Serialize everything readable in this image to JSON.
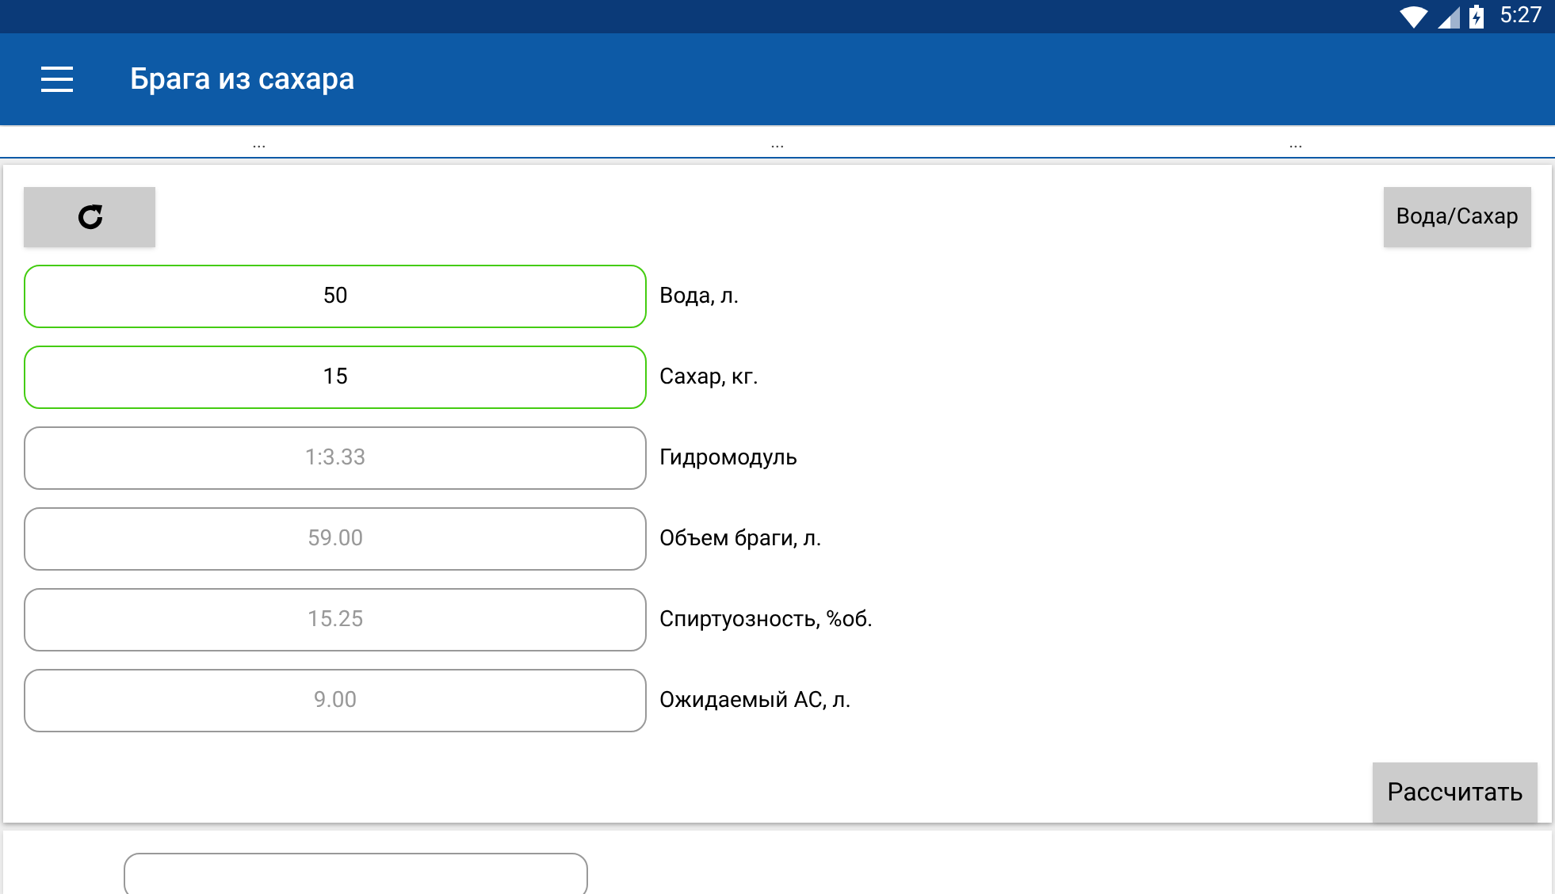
{
  "status_bar": {
    "time": "5:27"
  },
  "app_bar": {
    "title": "Брага из сахара"
  },
  "tabs": [
    {
      "label": "..."
    },
    {
      "label": "..."
    },
    {
      "label": "..."
    }
  ],
  "card": {
    "toggle_button": "Вода/Сахар",
    "fields": [
      {
        "value": "50",
        "label": "Вода, л.",
        "editable": true
      },
      {
        "value": "15",
        "label": "Сахар, кг.",
        "editable": true
      },
      {
        "value": "1:3.33",
        "label": "Гидромодуль",
        "editable": false
      },
      {
        "value": "59.00",
        "label": "Объем браги, л.",
        "editable": false
      },
      {
        "value": "15.25",
        "label": "Спиртуозность, %об.",
        "editable": false
      },
      {
        "value": "9.00",
        "label": "Ожидаемый АС, л.",
        "editable": false
      }
    ],
    "calculate_button": "Рассчитать"
  }
}
